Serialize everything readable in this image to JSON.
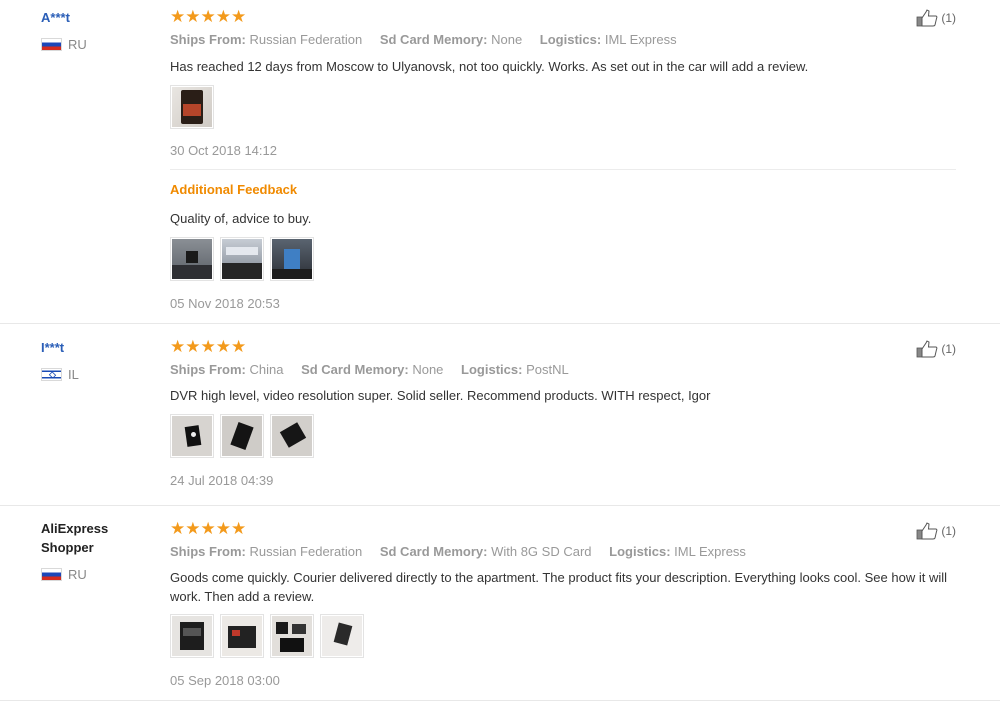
{
  "reviews": [
    {
      "user": "A***t",
      "country": "RU",
      "stars": 5,
      "ships_from_label": "Ships From:",
      "ships_from": "Russian Federation",
      "sd_label": "Sd Card Memory:",
      "sd": "None",
      "logistics_label": "Logistics:",
      "logistics": "IML Express",
      "text": "Has reached 12 days from Moscow to Ulyanovsk, not too quickly. Works. As set out in the car will add a review.",
      "date": "30 Oct 2018 14:12",
      "helpful": "(1)",
      "additional_label": "Additional Feedback",
      "additional_text": "Quality of, advice to buy.",
      "additional_date": "05 Nov 2018 20:53"
    },
    {
      "user": "I***t",
      "country": "IL",
      "stars": 5,
      "ships_from_label": "Ships From:",
      "ships_from": "China",
      "sd_label": "Sd Card Memory:",
      "sd": "None",
      "logistics_label": "Logistics:",
      "logistics": "PostNL",
      "text": "DVR high level, video resolution super. Solid seller. Recommend products. WITH respect, Igor",
      "date": "24 Jul 2018 04:39",
      "helpful": "(1)"
    },
    {
      "user": "AliExpress Shopper",
      "country": "RU",
      "stars": 5,
      "ships_from_label": "Ships From:",
      "ships_from": "Russian Federation",
      "sd_label": "Sd Card Memory:",
      "sd": "With 8G SD Card",
      "logistics_label": "Logistics:",
      "logistics": "IML Express",
      "text": "Goods come quickly. Courier delivered directly to the apartment. The product fits your description. Everything looks cool. See how it will work. Then add a review.",
      "date": "05 Sep 2018 03:00",
      "helpful": "(1)"
    }
  ],
  "icons": {
    "star": "star-icon",
    "helpful": "thumbs-up-icon"
  },
  "colors": {
    "star": "#f39a1c",
    "user_link": "#2a5eb7",
    "additional": "#f08a00"
  }
}
